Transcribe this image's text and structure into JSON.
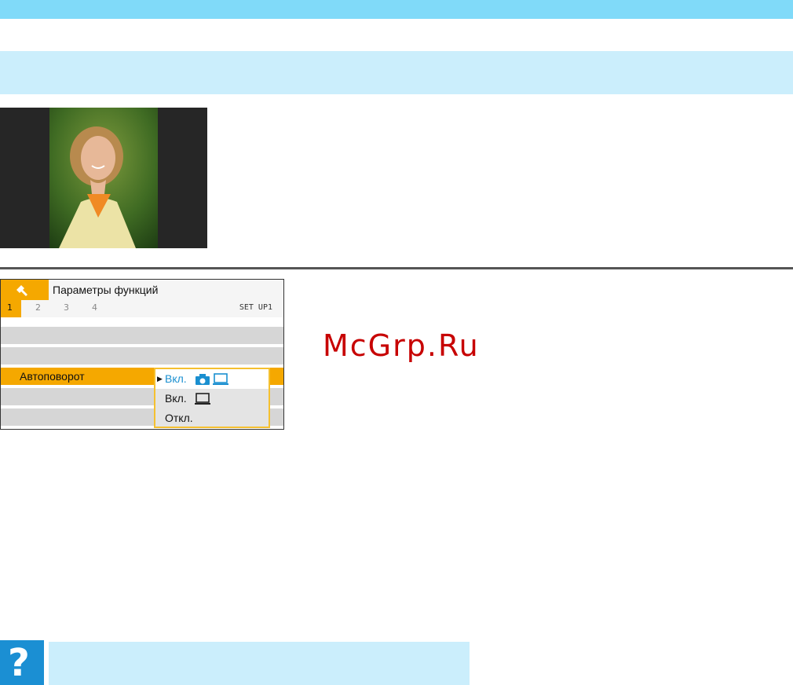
{
  "menu": {
    "title": "Параметры функций",
    "tabs": [
      "1",
      "2",
      "3",
      "4"
    ],
    "setup_label": "SET UP1",
    "selected_item": "Автоповорот",
    "options": [
      {
        "label": "Вкл.",
        "icons": [
          "camera-icon",
          "monitor-icon"
        ],
        "active": true
      },
      {
        "label": "Вкл.",
        "icons": [
          "monitor-icon"
        ],
        "active": false
      },
      {
        "label": "Откл.",
        "icons": [],
        "active": false
      }
    ]
  },
  "watermark": "McGrp.Ru",
  "help_icon_glyph": "?",
  "colors": {
    "top_bar": "#80daf9",
    "band": "#cbeefc",
    "menu_accent": "#f5a800",
    "option_blue": "#1a8fd0",
    "help_icon": "#1b8fd3",
    "watermark": "#c70000"
  }
}
